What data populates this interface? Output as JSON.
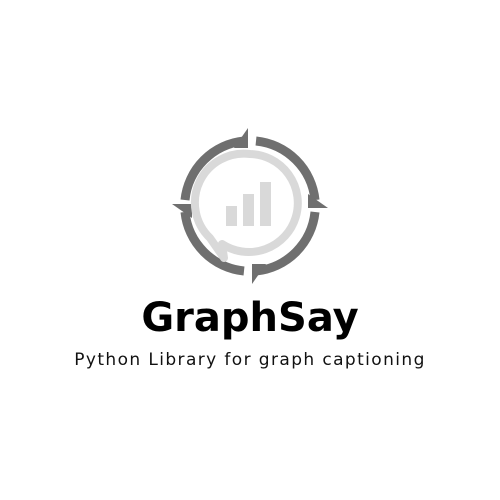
{
  "brand": {
    "name": "GraphSay",
    "tagline": "Python Library for graph captioning"
  },
  "colors": {
    "background": "#ffffff",
    "ring": "#6f6f6f",
    "bubble": "#d9d9d9",
    "text": "#000000"
  },
  "logo": {
    "icon": "compass-chart-speech-bubble-icon"
  }
}
